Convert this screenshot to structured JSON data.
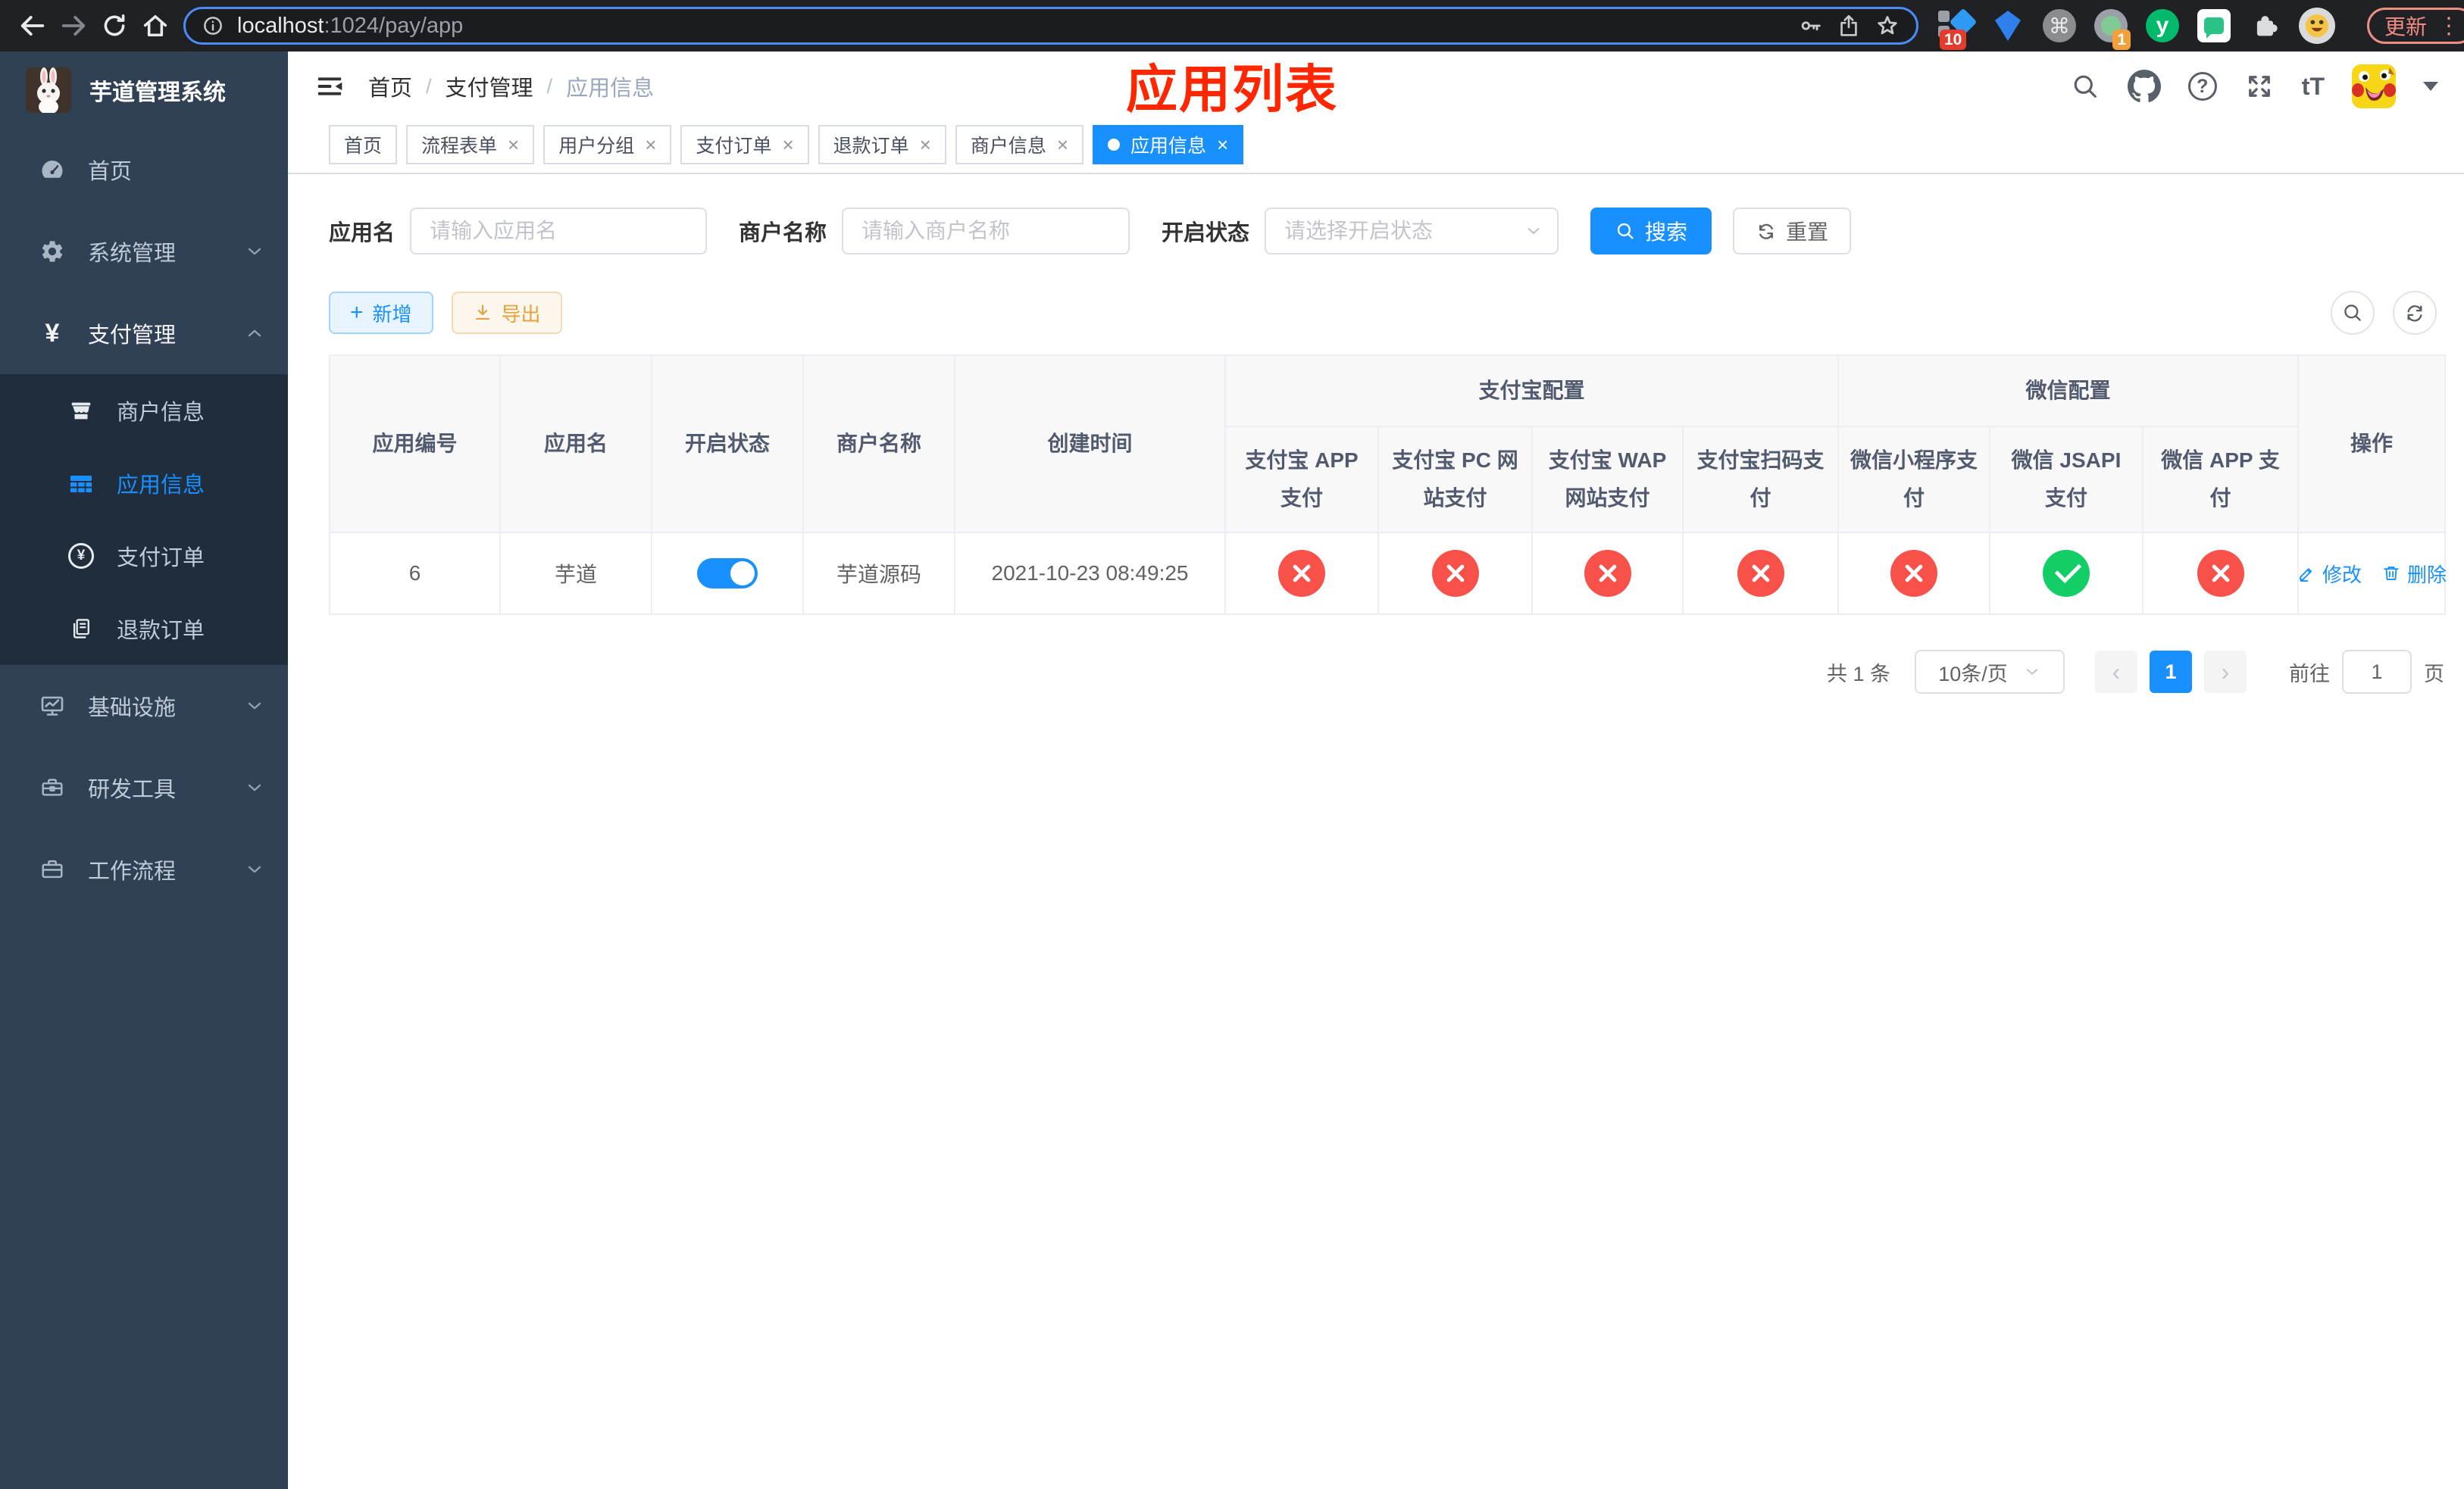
{
  "colors": {
    "accent": "#1890ff",
    "success": "#13ce66",
    "danger": "#f8514a",
    "warning": "#e6a23c",
    "sidebar_bg": "#304156",
    "submenu_bg": "#1f2d3d",
    "annotation_red": "#ff2600",
    "chrome_bg": "#202124",
    "omnibox_focus_ring": "#4c8bf5"
  },
  "icons": {
    "close": "×",
    "plus": "+",
    "prev": "‹",
    "next": "›",
    "more_vertical": "⋮",
    "command": "⌘",
    "question": "?",
    "yen": "¥",
    "yuque": "y",
    "text_size": "tT",
    "breadcrumb_separator": "/"
  },
  "browser": {
    "url_host": "localhost",
    "url_rest": ":1024/pay/app",
    "update_label": "更新",
    "ext_badge_pinned": "10",
    "ext_badge_session": "1"
  },
  "sidebar": {
    "title": "芋道管理系统",
    "items": [
      {
        "label": "首页"
      },
      {
        "label": "系统管理"
      },
      {
        "label": "支付管理"
      },
      {
        "label": "基础设施"
      },
      {
        "label": "研发工具"
      },
      {
        "label": "工作流程"
      }
    ],
    "submenu": [
      {
        "label": "商户信息"
      },
      {
        "label": "应用信息"
      },
      {
        "label": "支付订单"
      },
      {
        "label": "退款订单"
      }
    ]
  },
  "header": {
    "breadcrumb": [
      "首页",
      "支付管理",
      "应用信息"
    ],
    "annotation": "应用列表"
  },
  "tabs": [
    {
      "label": "首页"
    },
    {
      "label": "流程表单"
    },
    {
      "label": "用户分组"
    },
    {
      "label": "支付订单"
    },
    {
      "label": "退款订单"
    },
    {
      "label": "商户信息"
    },
    {
      "label": "应用信息"
    }
  ],
  "filters": {
    "app_name_label": "应用名",
    "app_name_placeholder": "请输入应用名",
    "merchant_label": "商户名称",
    "merchant_placeholder": "请输入商户名称",
    "status_label": "开启状态",
    "status_placeholder": "请选择开启状态",
    "search_label": "搜索",
    "reset_label": "重置"
  },
  "toolbar": {
    "add_label": "新增",
    "export_label": "导出"
  },
  "table": {
    "columns": [
      "应用编号",
      "应用名",
      "开启状态",
      "商户名称",
      "创建时间"
    ],
    "group_alipay": {
      "label": "支付宝配置",
      "children": [
        "支付宝 APP 支付",
        "支付宝 PC 网站支付",
        "支付宝 WAP 网站支付",
        "支付宝扫码支付"
      ]
    },
    "group_wechat": {
      "label": "微信配置",
      "children": [
        "微信小程序支付",
        "微信 JSAPI 支付",
        "微信 APP 支付"
      ]
    },
    "action_column": "操作",
    "row": {
      "id": "6",
      "name": "芋道",
      "enabled": "on",
      "merchant": "芋道源码",
      "created_at": "2021-10-23 08:49:25",
      "statuses": [
        {
          "column": "支付宝 APP 支付",
          "state": "disabled"
        },
        {
          "column": "支付宝 PC 网站支付",
          "state": "disabled"
        },
        {
          "column": "支付宝 WAP 网站支付",
          "state": "disabled"
        },
        {
          "column": "支付宝扫码支付",
          "state": "disabled"
        },
        {
          "column": "微信小程序支付",
          "state": "disabled"
        },
        {
          "column": "微信 JSAPI 支付",
          "state": "enabled"
        },
        {
          "column": "微信 APP 支付",
          "state": "disabled"
        }
      ],
      "edit_label": "修改",
      "delete_label": "删除"
    }
  },
  "pagination": {
    "total": "共 1 条",
    "page_size": "10条/页",
    "page": "1",
    "goto_label": "前往",
    "goto_value": "1",
    "unit_label": "页"
  }
}
